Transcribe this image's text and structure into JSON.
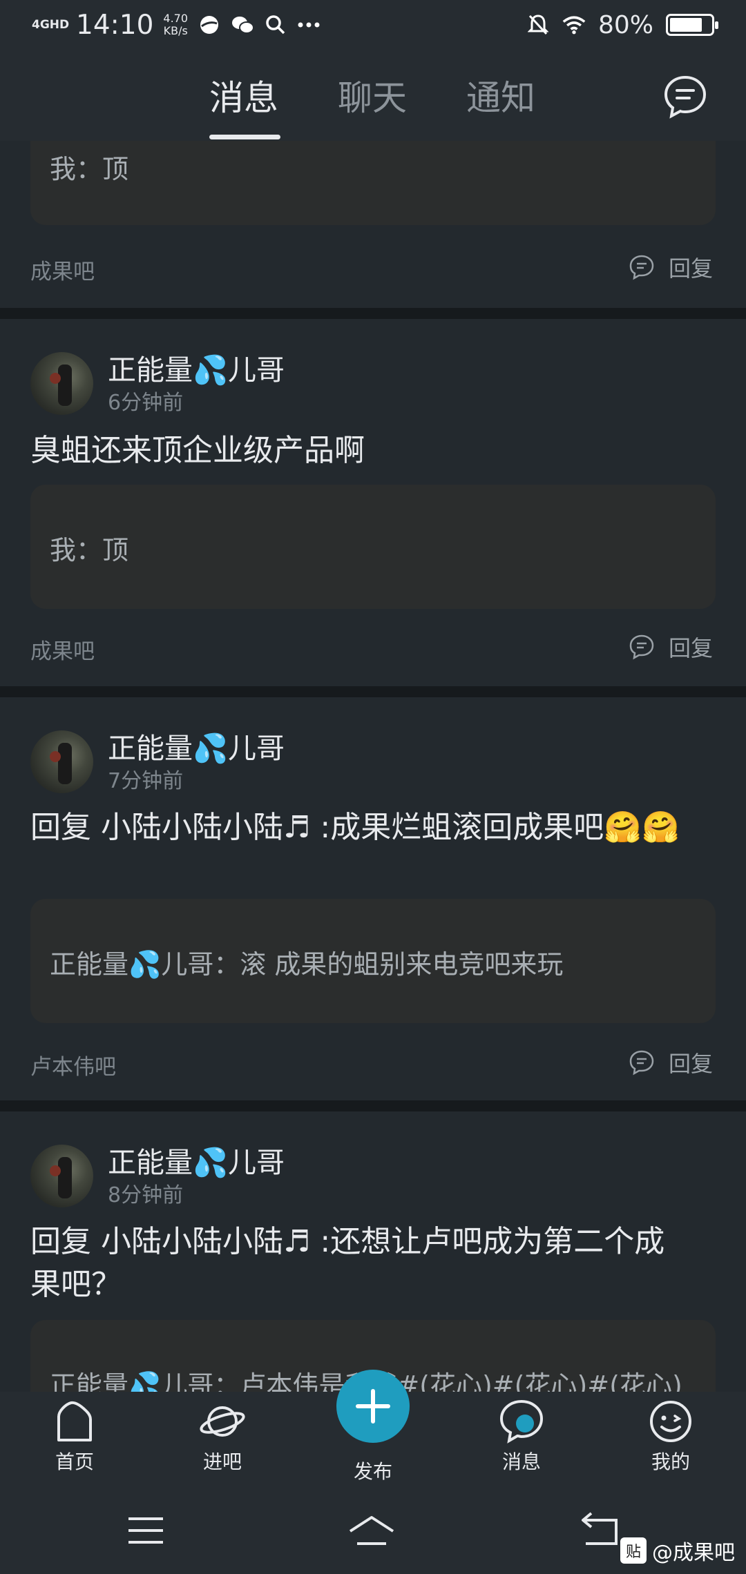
{
  "status_bar": {
    "network": "4GHD",
    "time": "14:10",
    "speed_value": "4.70",
    "speed_unit": "KB/s",
    "battery": "80%",
    "battery_level": 0.8
  },
  "header": {
    "tabs": [
      {
        "label": "消息",
        "active": true
      },
      {
        "label": "聊天",
        "active": false
      },
      {
        "label": "通知",
        "active": false
      }
    ]
  },
  "cards": [
    {
      "quote": "我：顶",
      "forum": "成果吧",
      "reply_label": "回复"
    },
    {
      "author": "正能量💦儿哥",
      "time": "6分钟前",
      "content": "臭蛆还来顶企业级产品啊",
      "quote": "我：顶",
      "forum": "成果吧",
      "reply_label": "回复"
    },
    {
      "author": "正能量💦儿哥",
      "time": "7分钟前",
      "content": "回复 小陆小陆小陆♬ :成果烂蛆滚回成果吧🤗🤗",
      "quote": "正能量💦儿哥：滚 成果的蛆别来电竞吧来玩",
      "forum": "卢本伟吧",
      "reply_label": "回复"
    },
    {
      "author": "正能量💦儿哥",
      "time": "8分钟前",
      "content": "回复 小陆小陆小陆♬ :还想让卢吧成为第二个成果吧？",
      "quote": "正能量💦儿哥：卢本伟是我爹#(花心)#(花心)#(花心)"
    }
  ],
  "bottom_nav": {
    "items": [
      {
        "label": "首页",
        "icon": "home-icon"
      },
      {
        "label": "进吧",
        "icon": "planet-icon"
      },
      {
        "label": "发布",
        "icon": "plus-icon"
      },
      {
        "label": "消息",
        "icon": "message-bubble-icon"
      },
      {
        "label": "我的",
        "icon": "smiley-face-icon"
      }
    ]
  },
  "watermark": {
    "badge": "贴",
    "text": "@成果吧"
  },
  "colors": {
    "accent": "#1f9dbf",
    "background": "#1f2429",
    "card": "#23292e",
    "quote": "#2b2d2d"
  }
}
